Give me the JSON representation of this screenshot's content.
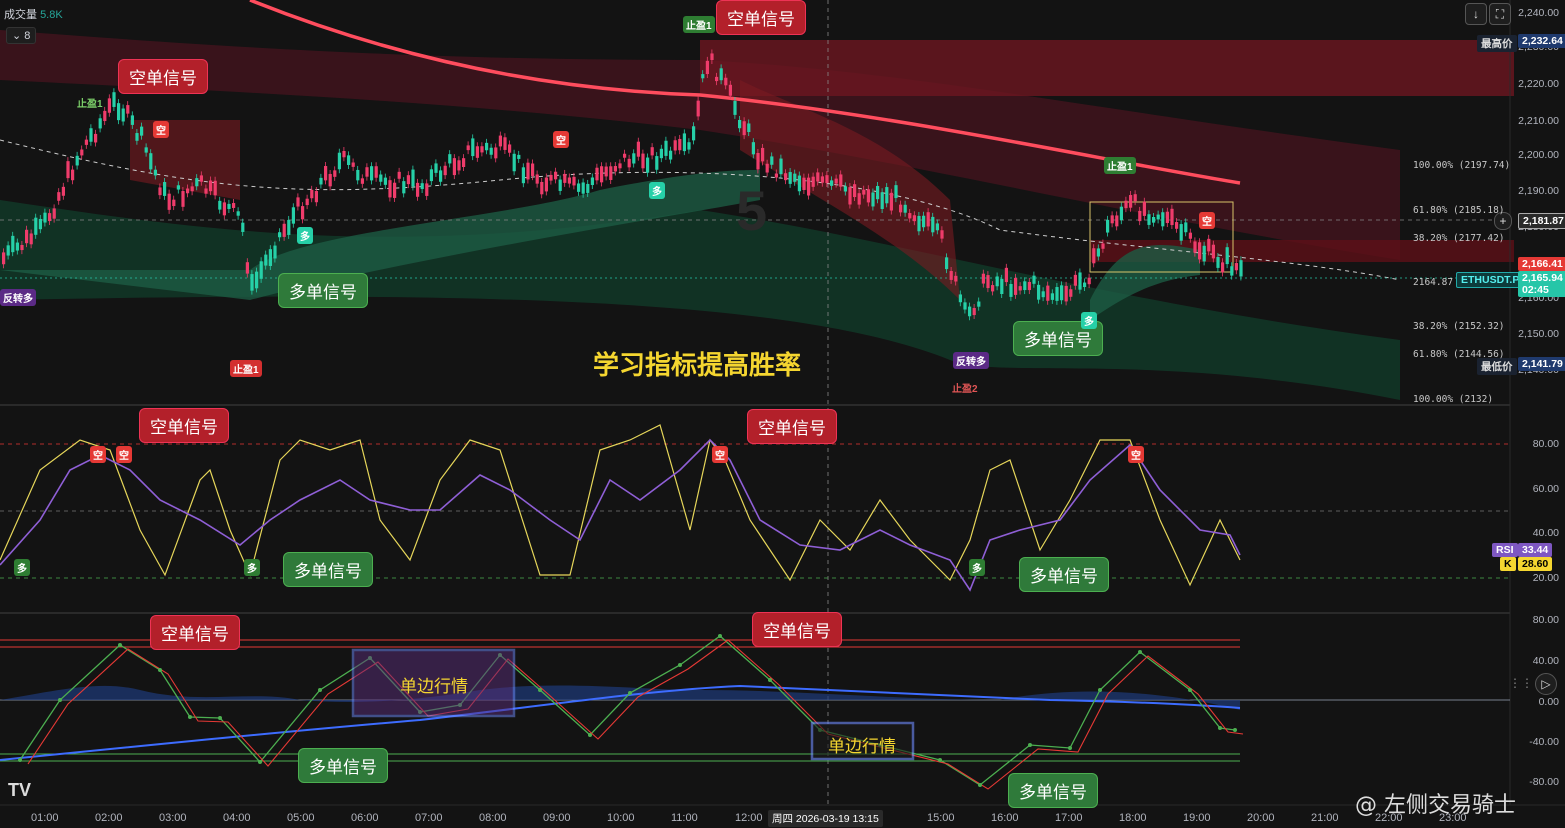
{
  "header": {
    "volume_label": "成交量",
    "volume_value": "5.8K",
    "collapse_count": "8"
  },
  "price_axis": {
    "ticks": [
      "2,240.00",
      "2,230.00",
      "2,220.00",
      "2,210.00",
      "2,200.00",
      "2,190.00",
      "2,180.00",
      "2,170.00",
      "2,160.00",
      "2,150.00",
      "2,140.00"
    ],
    "high_label": "最高价",
    "high_value": "2,232.64",
    "low_label": "最低价",
    "low_value": "2,141.79",
    "crosshair_value": "2,181.87",
    "red_value": "2,166.41",
    "symbol": "ETHUSDT.P",
    "last_price": "2,165.94",
    "countdown": "02:45"
  },
  "fib": {
    "levels": [
      "100.00%  (2197.74)",
      "61.80%  (2185.18)",
      "38.20%  (2177.42)",
      "2164.87",
      "38.20%  (2152.32)",
      "61.80%  (2144.56)",
      "100.00%  (2132)"
    ]
  },
  "rsi_axis": {
    "ticks": [
      "80.00",
      "60.00",
      "40.00",
      "20.00"
    ],
    "rsi_label": "RSI",
    "rsi_value": "33.44",
    "k_label": "K",
    "k_value": "28.60"
  },
  "osc_axis": {
    "ticks": [
      "80.00",
      "40.00",
      "0.00",
      "-40.00",
      "-80.00"
    ]
  },
  "time_axis": {
    "ticks": [
      "01:00",
      "02:00",
      "03:00",
      "04:00",
      "05:00",
      "06:00",
      "07:00",
      "08:00",
      "09:00",
      "10:00",
      "11:00",
      "12:00",
      "15:00",
      "16:00",
      "17:00",
      "18:00",
      "19:00",
      "20:00",
      "21:00",
      "22:00",
      "23:00"
    ],
    "crosshair_label": "周四 2026-03-19   13:15"
  },
  "callouts": {
    "short": "空单信号",
    "long": "多单信号",
    "trend": "单边行情"
  },
  "banner": "学习指标提高胜率",
  "watermark": "@ 左侧交易骑士",
  "markers": {
    "tp1": "止盈1",
    "tp2": "止盈2",
    "short": "空",
    "long": "多",
    "reverse_long": "反转多",
    "nine": "5"
  },
  "colors": {
    "bull": "#26d0a8",
    "bear": "#ef3c6b",
    "ma": "#ff4d5e",
    "red_band": "#8b1a26",
    "green_band": "#1e5e45",
    "k_line": "#e6d65a",
    "rsi_line": "#8f5fd6"
  }
}
